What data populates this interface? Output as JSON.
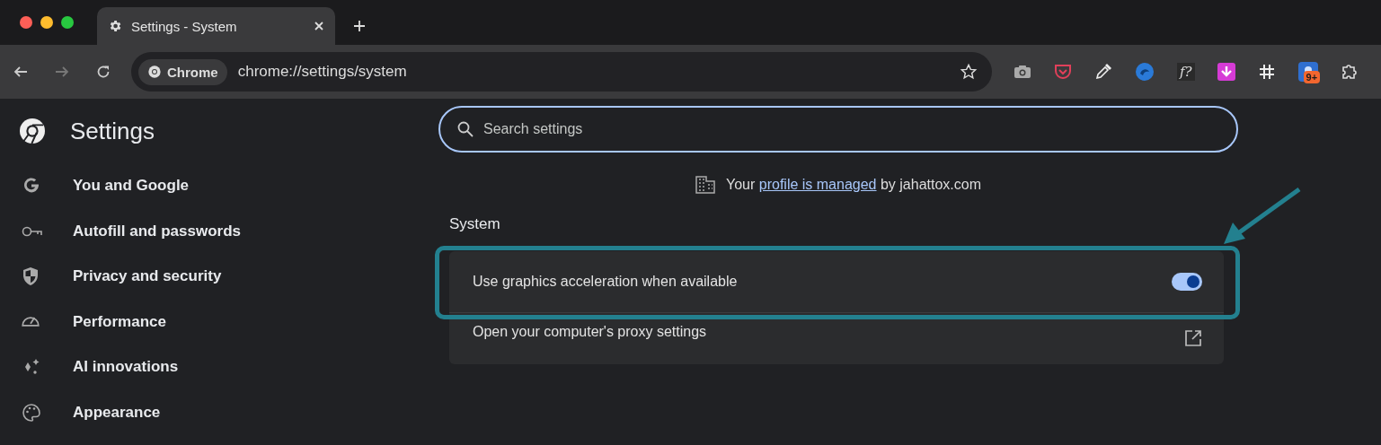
{
  "tab": {
    "title": "Settings - System",
    "selected": true
  },
  "toolbar": {
    "site_chip": "Chrome",
    "url": "chrome://settings/system",
    "bookmarked": false,
    "extensions": [
      {
        "kind": "camera"
      },
      {
        "kind": "pocket"
      },
      {
        "kind": "eyedropper"
      },
      {
        "kind": "swirl"
      },
      {
        "kind": "text",
        "label": "f?"
      },
      {
        "kind": "download"
      },
      {
        "kind": "hash"
      },
      {
        "kind": "app",
        "badge": "9+"
      },
      {
        "kind": "puzzle"
      }
    ]
  },
  "sidebar": {
    "title": "Settings",
    "items": [
      {
        "label": "You and Google",
        "selected": false
      },
      {
        "label": "Autofill and passwords",
        "selected": false
      },
      {
        "label": "Privacy and security",
        "selected": false
      },
      {
        "label": "Performance",
        "selected": false
      },
      {
        "label": "AI innovations",
        "selected": false
      },
      {
        "label": "Appearance",
        "selected": false
      }
    ]
  },
  "search": {
    "placeholder": "Search settings"
  },
  "managed_notice": {
    "before": "Your",
    "link": "profile is managed",
    "after": "by jahattox.com"
  },
  "section": {
    "title": "System",
    "rows": [
      {
        "kind": "toggle",
        "label": "Use graphics acceleration when available",
        "on": true,
        "highlighted": true
      },
      {
        "kind": "external",
        "label": "Open your computer's proxy settings",
        "highlighted": false
      }
    ]
  }
}
